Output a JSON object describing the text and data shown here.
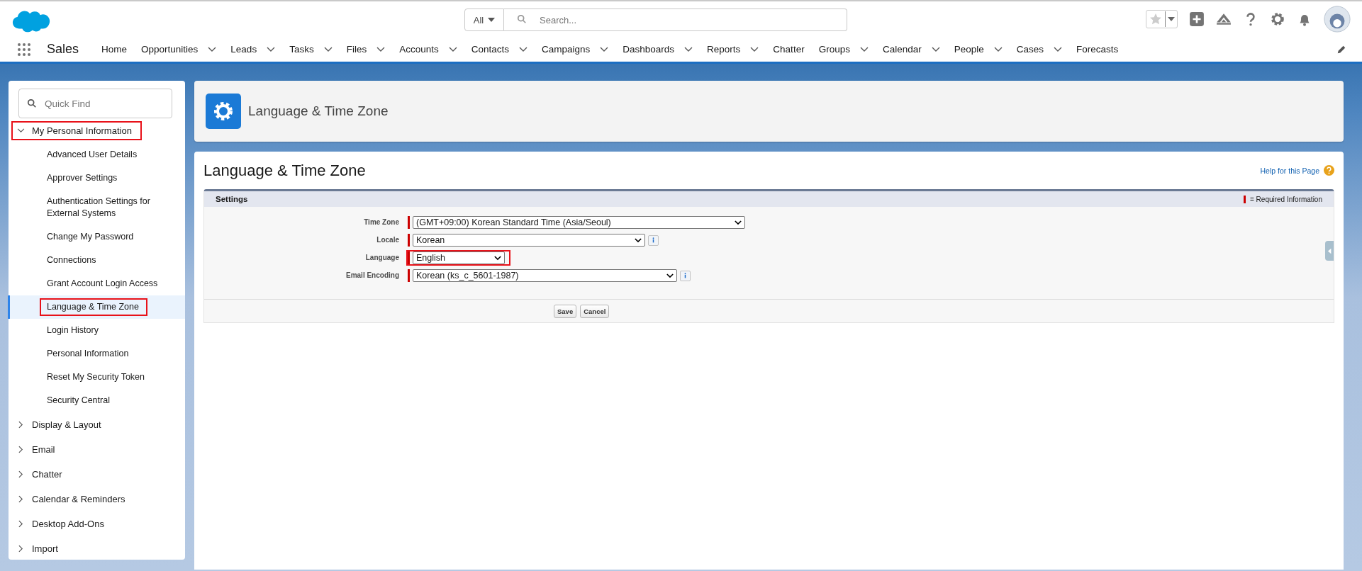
{
  "header": {
    "search_scope": "All",
    "search": {
      "placeholder": "Search..."
    }
  },
  "app_name": "Sales",
  "nav": [
    {
      "label": "Home",
      "has_menu": false
    },
    {
      "label": "Opportunities",
      "has_menu": true
    },
    {
      "label": "Leads",
      "has_menu": true
    },
    {
      "label": "Tasks",
      "has_menu": true
    },
    {
      "label": "Files",
      "has_menu": true
    },
    {
      "label": "Accounts",
      "has_menu": true
    },
    {
      "label": "Contacts",
      "has_menu": true
    },
    {
      "label": "Campaigns",
      "has_menu": true
    },
    {
      "label": "Dashboards",
      "has_menu": true
    },
    {
      "label": "Reports",
      "has_menu": true
    },
    {
      "label": "Chatter",
      "has_menu": false
    },
    {
      "label": "Groups",
      "has_menu": true
    },
    {
      "label": "Calendar",
      "has_menu": true
    },
    {
      "label": "People",
      "has_menu": true
    },
    {
      "label": "Cases",
      "has_menu": true
    },
    {
      "label": "Forecasts",
      "has_menu": false
    }
  ],
  "sidebar": {
    "quick_find": {
      "placeholder": "Quick Find"
    },
    "sections": [
      {
        "label": "My Personal Information",
        "expanded": true,
        "highlighted": true,
        "children": [
          {
            "label": "Advanced User Details",
            "selected": false,
            "highlighted": false
          },
          {
            "label": "Approver Settings",
            "selected": false,
            "highlighted": false
          },
          {
            "label": "Authentication Settings for External Systems",
            "selected": false,
            "highlighted": false
          },
          {
            "label": "Change My Password",
            "selected": false,
            "highlighted": false
          },
          {
            "label": "Connections",
            "selected": false,
            "highlighted": false
          },
          {
            "label": "Grant Account Login Access",
            "selected": false,
            "highlighted": false
          },
          {
            "label": "Language & Time Zone",
            "selected": true,
            "highlighted": true
          },
          {
            "label": "Login History",
            "selected": false,
            "highlighted": false
          },
          {
            "label": "Personal Information",
            "selected": false,
            "highlighted": false
          },
          {
            "label": "Reset My Security Token",
            "selected": false,
            "highlighted": false
          },
          {
            "label": "Security Central",
            "selected": false,
            "highlighted": false
          }
        ]
      },
      {
        "label": "Display & Layout",
        "expanded": false,
        "highlighted": false
      },
      {
        "label": "Email",
        "expanded": false,
        "highlighted": false
      },
      {
        "label": "Chatter",
        "expanded": false,
        "highlighted": false
      },
      {
        "label": "Calendar & Reminders",
        "expanded": false,
        "highlighted": false
      },
      {
        "label": "Desktop Add-Ons",
        "expanded": false,
        "highlighted": false
      },
      {
        "label": "Import",
        "expanded": false,
        "highlighted": false
      }
    ]
  },
  "page_header": {
    "title": "Language & Time Zone"
  },
  "content": {
    "title": "Language & Time Zone",
    "help_link": "Help for this Page",
    "section": {
      "title": "Settings",
      "required_legend": "= Required Information",
      "fields": [
        {
          "label": "Time Zone",
          "value": "(GMT+09:00) Korean Standard Time (Asia/Seoul)",
          "required": true,
          "info": false,
          "highlighted": false
        },
        {
          "label": "Locale",
          "value": "Korean",
          "required": true,
          "info": true,
          "highlighted": false
        },
        {
          "label": "Language",
          "value": "English",
          "required": true,
          "info": false,
          "highlighted": true
        },
        {
          "label": "Email Encoding",
          "value": "Korean (ks_c_5601-1987)",
          "required": true,
          "info": true,
          "highlighted": false
        }
      ],
      "buttons": [
        "Save",
        "Cancel"
      ]
    }
  }
}
